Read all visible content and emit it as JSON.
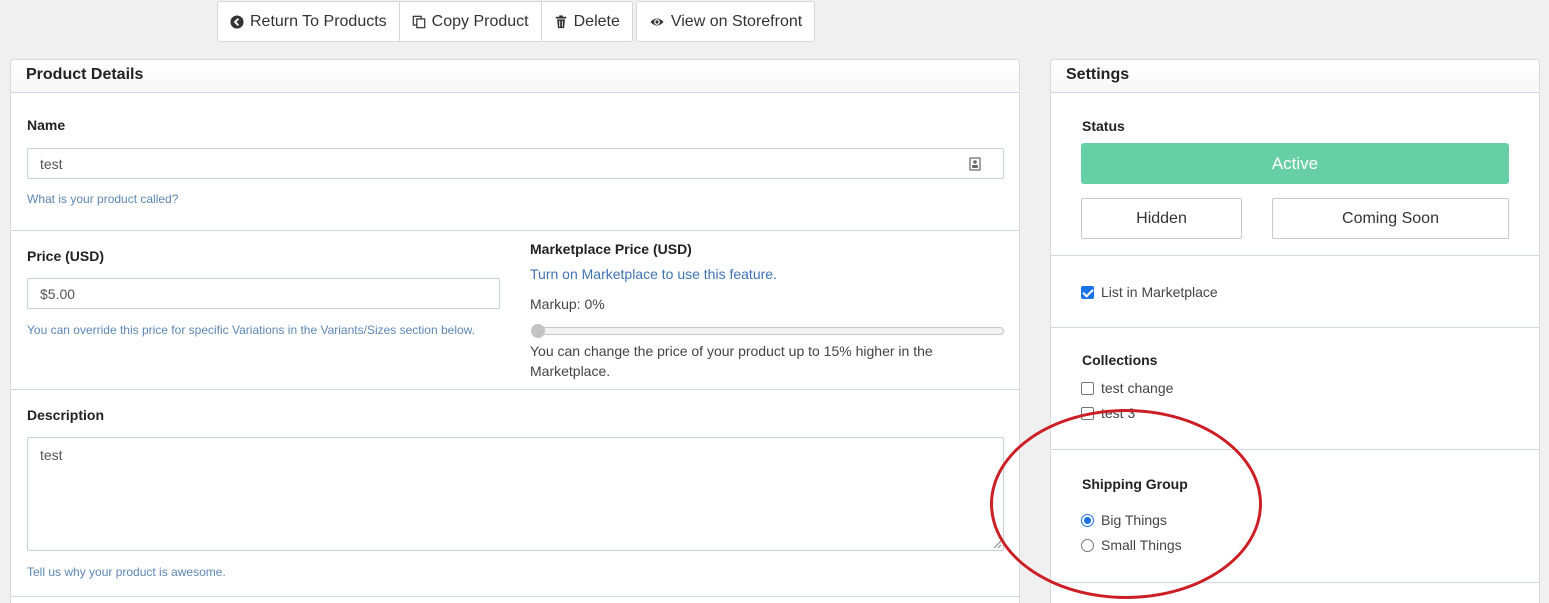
{
  "toolbar": {
    "return_label": "Return To Products",
    "copy_label": "Copy Product",
    "delete_label": "Delete",
    "storefront_label": "View on Storefront"
  },
  "product_details": {
    "title": "Product Details",
    "name_label": "Name",
    "name_value": "test",
    "name_help": "What is your product called?",
    "price_label": "Price (USD)",
    "price_value": "$5.00",
    "price_help": "You can override this price for specific Variations in the Variants/Sizes section below.",
    "marketplace_price_label": "Marketplace Price (USD)",
    "marketplace_notice": "Turn on Marketplace to use this feature.",
    "markup_text": "Markup: 0%",
    "markup_value_percent": 0,
    "markup_help": "You can change the price of your product up to 15% higher in the Marketplace.",
    "description_label": "Description",
    "description_value": "test",
    "description_help": "Tell us why your product is awesome."
  },
  "settings": {
    "title": "Settings",
    "status_label": "Status",
    "status_active": "Active",
    "status_hidden": "Hidden",
    "status_coming_soon": "Coming Soon",
    "list_in_marketplace": "List in Marketplace",
    "list_in_marketplace_checked": true,
    "collections_label": "Collections",
    "collections": [
      "test change",
      "test 3"
    ],
    "shipping_group_label": "Shipping Group",
    "shipping_groups": [
      "Big Things",
      "Small Things"
    ],
    "shipping_selected": "Big Things"
  },
  "colors": {
    "active_green": "#67cfa6",
    "help_blue": "#5b87b5",
    "annotation_red": "#cc1f25"
  }
}
